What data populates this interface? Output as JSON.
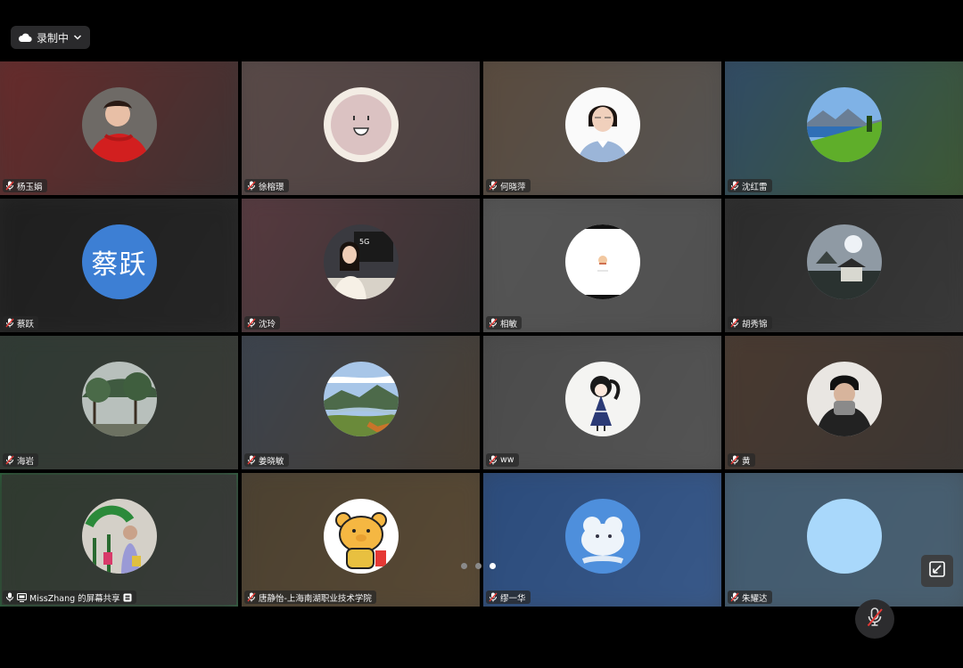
{
  "recording": {
    "label": "录制中",
    "icon": "cloud-icon"
  },
  "pagination": {
    "pages": 3,
    "current": 3
  },
  "participants": [
    {
      "name": "杨玉娟",
      "avatar": "photo-woman-red",
      "bg": [
        "#6b2a2a",
        "#3a3333"
      ]
    },
    {
      "name": "徐榕璟",
      "avatar": "smiley-face",
      "bg": [
        "#5a4a48",
        "#4a4040"
      ]
    },
    {
      "name": "何晓萍",
      "avatar": "photo-woman-portrait",
      "bg": [
        "#5a4a3c",
        "#555"
      ]
    },
    {
      "name": "沈红雷",
      "avatar": "photo-lake-landscape",
      "bg": [
        "#2f4a6a",
        "#3e5a30"
      ]
    },
    {
      "name": "蔡跃",
      "avatar": "initials",
      "initials": "蔡跃",
      "avatar_color": "#3d7fd4",
      "bg": [
        "#1e1e1e",
        "#262626"
      ]
    },
    {
      "name": "沈玲",
      "avatar": "photo-woman-desk",
      "bg": [
        "#5a3a40",
        "#333"
      ]
    },
    {
      "name": "相敏",
      "avatar": "white-sticker",
      "bg": [
        "#555",
        "#505050"
      ]
    },
    {
      "name": "胡秀锦",
      "avatar": "photo-sky-building",
      "bg": [
        "#2a2a2a",
        "#3a3a3a"
      ]
    },
    {
      "name": "海岩",
      "avatar": "photo-tree-fog",
      "bg": [
        "#2e3a33",
        "#3a3a36"
      ]
    },
    {
      "name": "姜晓敏",
      "avatar": "photo-valley-river",
      "bg": [
        "#3a4350",
        "#4a3e30"
      ]
    },
    {
      "name": "ww",
      "avatar": "cartoon-girl",
      "bg": [
        "#4a4a4a",
        "#555"
      ]
    },
    {
      "name": "黄",
      "avatar": "photo-man-cap",
      "bg": [
        "#4a3a30",
        "#3a3532"
      ]
    },
    {
      "name": "MissZhang 的屏幕共享",
      "avatar": "photo-plants-figure",
      "bg": [
        "#2e3a2e",
        "#3a3a3a"
      ],
      "active": true,
      "sharing": true
    },
    {
      "name": "唐静怡-上海南湖职业技术学院",
      "avatar": "cartoon-bear",
      "bg": [
        "#4a4030",
        "#5a4a35"
      ]
    },
    {
      "name": "缪一华",
      "avatar": "cartoon-dog-sky",
      "bg": [
        "#2a4a7a",
        "#3a5a8a"
      ]
    },
    {
      "name": "朱耀达",
      "avatar": "plain-light-blue",
      "avatar_color": "#a9d8fb",
      "bg": [
        "#415a70",
        "#4a6070"
      ]
    }
  ],
  "controls": {
    "mic_icon": "mic-muted-icon",
    "exit_icon": "exit-fullscreen-icon"
  }
}
